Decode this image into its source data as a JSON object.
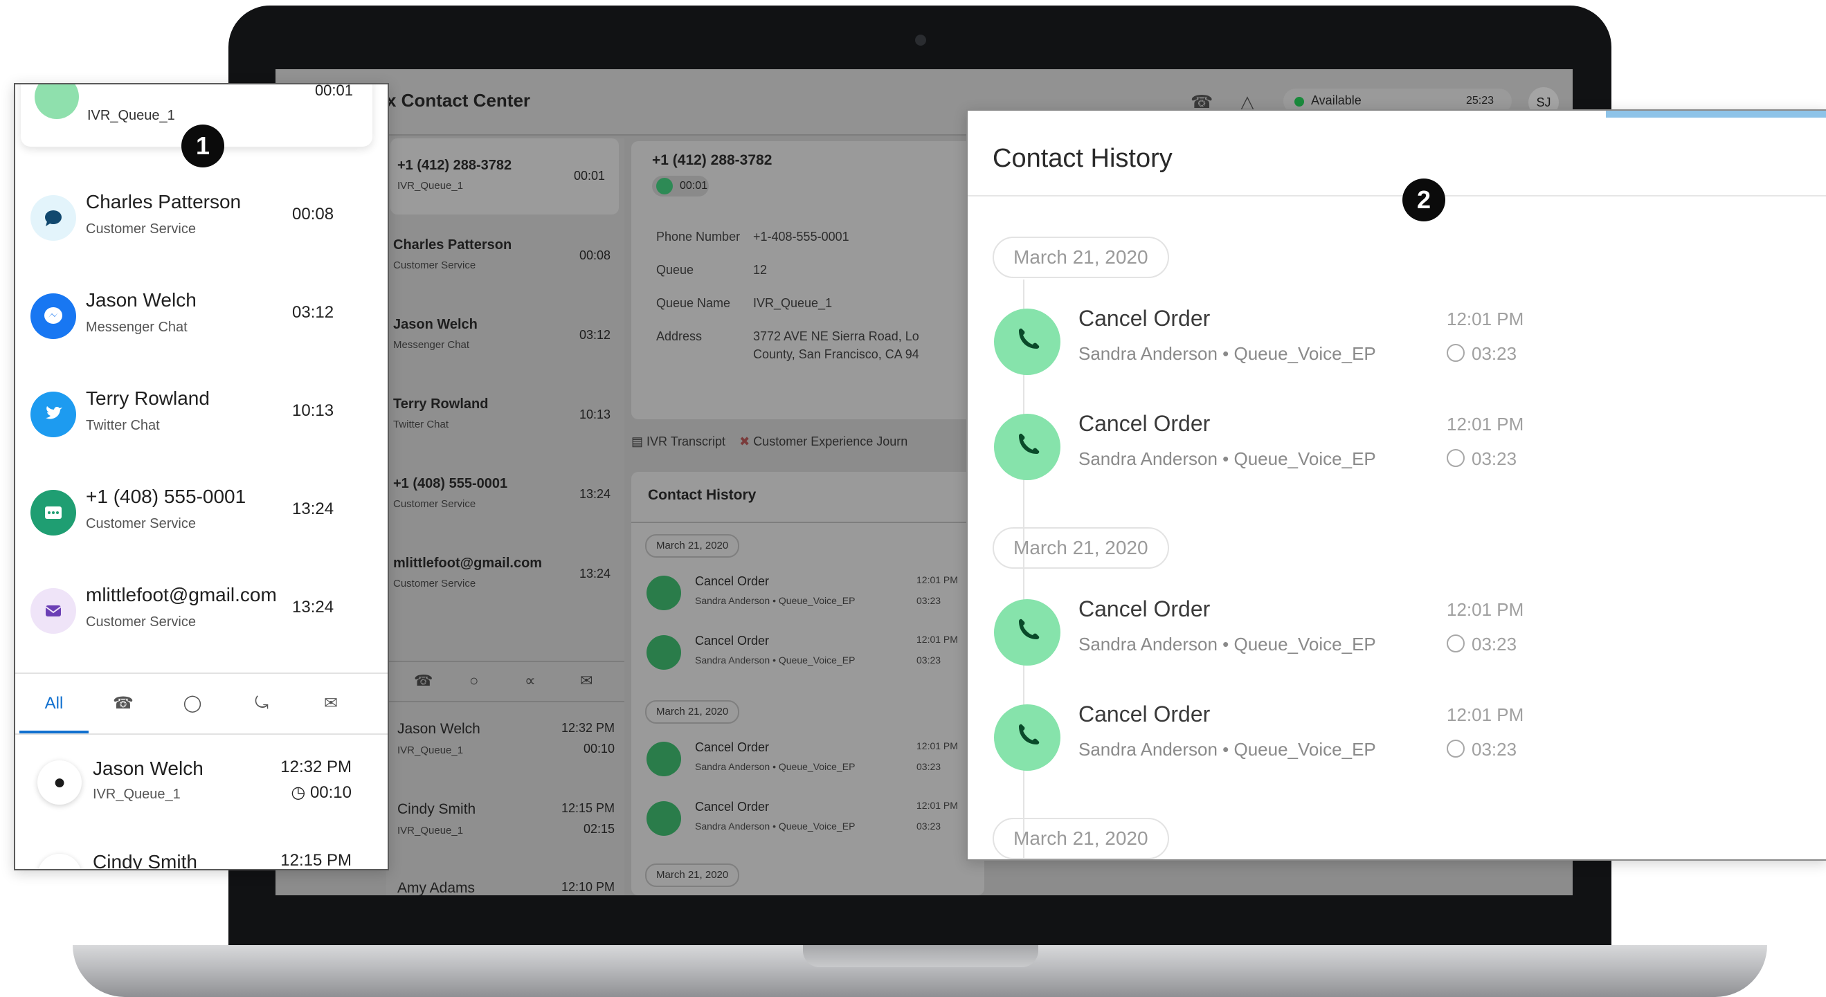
{
  "colors": {
    "accent": "#1170cf",
    "call_green": "#86e3ab",
    "status_green": "#1a8a3c"
  },
  "badges": {
    "one": "1",
    "two": "2"
  },
  "header": {
    "title": "x Contact Center",
    "status": "Available",
    "timer": "25:23",
    "initials": "SJ",
    "icons": [
      "phone-icon",
      "bell-icon"
    ]
  },
  "dim_list": [
    {
      "name": "+1 (412) 288-3782",
      "sub": "IVR_Queue_1",
      "time": "00:01"
    },
    {
      "name": "Charles Patterson",
      "sub": "Customer Service",
      "time": "00:08"
    },
    {
      "name": "Jason Welch",
      "sub": "Messenger Chat",
      "time": "03:12"
    },
    {
      "name": "Terry Rowland",
      "sub": "Twitter Chat",
      "time": "10:13"
    },
    {
      "name": "+1 (408) 555-0001",
      "sub": "Customer Service",
      "time": "13:24"
    },
    {
      "name": "mlittlefoot@gmail.com",
      "sub": "Customer Service",
      "time": "13:24"
    }
  ],
  "dim_recent": [
    {
      "name": "Jason Welch",
      "sub": "IVR_Queue_1",
      "time": "12:32 PM",
      "dur": "00:10"
    },
    {
      "name": "Cindy Smith",
      "sub": "IVR_Queue_1",
      "time": "12:15 PM",
      "dur": "02:15"
    },
    {
      "name": "Amy Adams",
      "sub": "",
      "time": "12:10 PM",
      "dur": ""
    }
  ],
  "call_card": {
    "number": "+1 (412) 288-3782",
    "timer": "00:01",
    "fields": [
      {
        "key": "Phone Number",
        "value": "+1-408-555-0001"
      },
      {
        "key": "Queue",
        "value": "12"
      },
      {
        "key": "Queue Name",
        "value": "IVR_Queue_1"
      },
      {
        "key": "Address",
        "value": "3772 AVE NE Sierra Road, Lo"
      },
      {
        "key": "",
        "value": "County, San Francisco, CA 94"
      }
    ],
    "tabs": [
      "IVR Transcript",
      "Customer Experience Journ"
    ]
  },
  "mid_history": {
    "title": "Contact History",
    "date": "March 21, 2020",
    "entries": [
      {
        "title": "Cancel Order",
        "sub": "Sandra Anderson • Queue_Voice_EP",
        "time": "12:01 PM",
        "dur": "03:23"
      }
    ]
  },
  "panel1": {
    "top": {
      "sub": "IVR_Queue_1",
      "time": "00:01"
    },
    "items": [
      {
        "name": "Charles Patterson",
        "sub": "Customer Service",
        "time": "00:08",
        "color": "#e3f4fb",
        "icon": "chat-icon"
      },
      {
        "name": "Jason Welch",
        "sub": "Messenger Chat",
        "time": "03:12",
        "color": "#1877f2",
        "icon": "messenger-icon"
      },
      {
        "name": "Terry Rowland",
        "sub": "Twitter Chat",
        "time": "10:13",
        "color": "#1d9bf0",
        "icon": "twitter-icon"
      },
      {
        "name": "+1 (408) 555-0001",
        "sub": "Customer Service",
        "time": "13:24",
        "color": "#1f9e72",
        "icon": "sms-icon"
      },
      {
        "name": "mlittlefoot@gmail.com",
        "sub": "Customer Service",
        "time": "13:24",
        "color": "#efe4f8",
        "icon": "email-icon"
      }
    ],
    "tabs": {
      "all": "All"
    },
    "recent": [
      {
        "name": "Jason Welch",
        "sub": "IVR_Queue_1",
        "time": "12:32 PM",
        "dur": "00:10"
      },
      {
        "name": "Cindy Smith",
        "sub": "",
        "time": "12:15 PM",
        "dur": ""
      }
    ]
  },
  "panel2": {
    "title": "Contact History",
    "groups": [
      {
        "date": "March 21, 2020"
      },
      {
        "date": "March 21, 2020"
      },
      {
        "date": "March 21, 2020"
      }
    ],
    "entries": [
      {
        "title": "Cancel Order",
        "sub": "Sandra Anderson • Queue_Voice_EP",
        "time": "12:01 PM",
        "dur": "03:23"
      },
      {
        "title": "Cancel Order",
        "sub": "Sandra Anderson • Queue_Voice_EP",
        "time": "12:01 PM",
        "dur": "03:23"
      },
      {
        "title": "Cancel Order",
        "sub": "Sandra Anderson • Queue_Voice_EP",
        "time": "12:01 PM",
        "dur": "03:23"
      },
      {
        "title": "Cancel Order",
        "sub": "Sandra Anderson • Queue_Voice_EP",
        "time": "12:01 PM",
        "dur": "03:23"
      }
    ]
  }
}
